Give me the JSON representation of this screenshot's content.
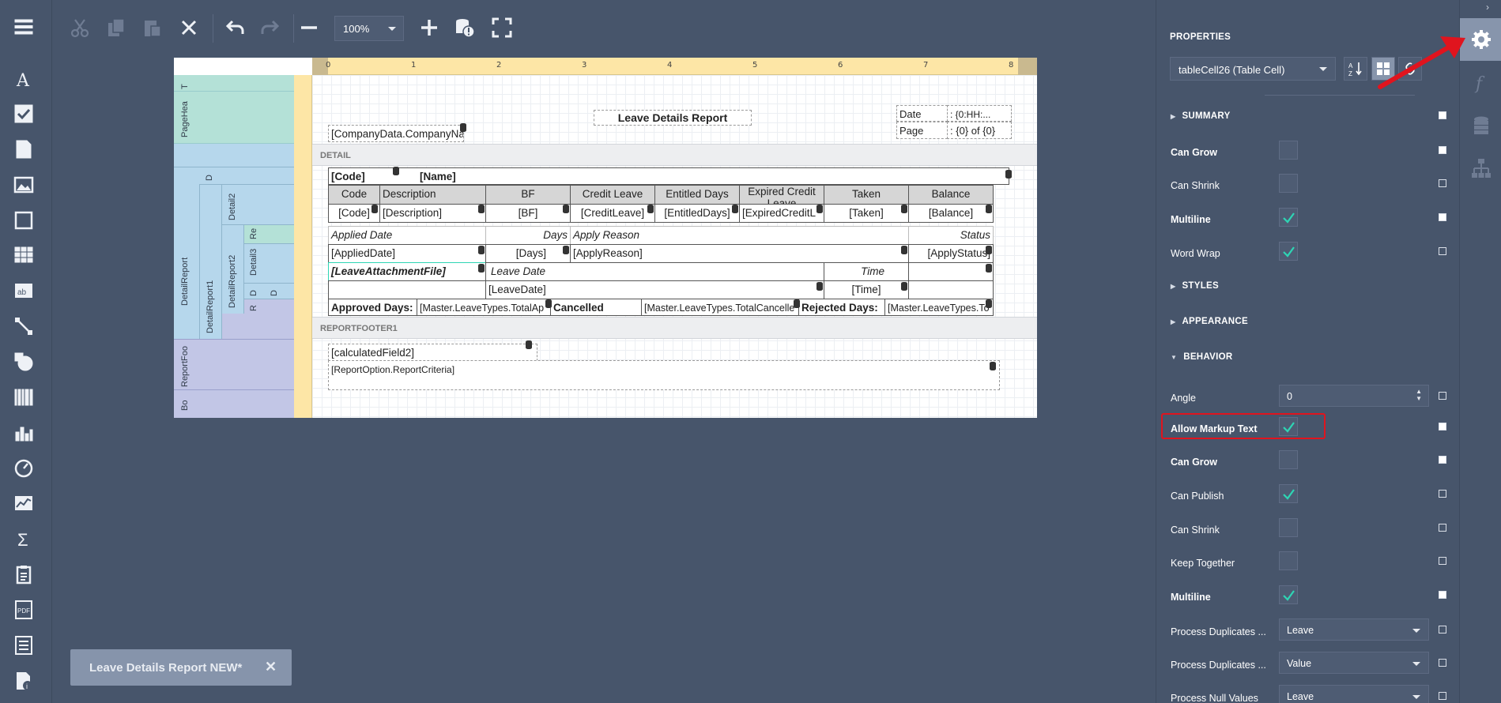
{
  "toolbar": {
    "zoom_value": "100%"
  },
  "document_tab": {
    "label": "Leave Details Report NEW*",
    "close": "✕"
  },
  "ruler_ticks": [
    "0",
    "1",
    "2",
    "3",
    "4",
    "5",
    "6",
    "7",
    "8"
  ],
  "bands": {
    "page_header": "PageHea",
    "top_margin": "T",
    "detail_strip": "DETAIL",
    "detail_report": "DetailReport",
    "detail_report1": "DetailReport1",
    "detail_report2": "DetailReport2",
    "detail2": "Detail2",
    "detail3": "Detail3",
    "d": "D",
    "re": "Re",
    "r": "R",
    "report_footer_strip": "REPORTFOOTER1",
    "report_footer": "ReportFoo",
    "bottom_margin": "Bo"
  },
  "report": {
    "title": "Leave Details Report",
    "company": "[CompanyData.CompanyName]",
    "date_label": "Date",
    "date_value": ": {0:HH:...",
    "page_label": "Page",
    "page_value": ": {0} of {0}",
    "code_bold": "[Code]",
    "name_bold": "[Name]",
    "headers": [
      "Code",
      "Description",
      "BF",
      "Credit Leave",
      "Entitled Days",
      "Expired Credit Leave",
      "Taken",
      "Balance"
    ],
    "values": [
      "[Code]",
      "[Description]",
      "[BF]",
      "[CreditLeave]",
      "[EntitledDays]",
      "[ExpiredCreditL",
      "[Taken]",
      "[Balance]"
    ],
    "applied_date_lbl": "Applied Date",
    "days_lbl": "Days",
    "apply_reason_lbl": "Apply Reason",
    "status_lbl": "Status",
    "applied_date_val": "[AppliedDate]",
    "days_val": "[Days]",
    "apply_reason_val": "[ApplyReason]",
    "apply_status_val": "[ApplyStatus]",
    "attachment": "[LeaveAttachmentFile]",
    "leave_date_lbl": "Leave Date",
    "time_lbl": "Time",
    "leave_date_val": "[LeaveDate]",
    "time_val": "[Time]",
    "approved_days_lbl": "Approved Days:",
    "approved_days_val": "[Master.LeaveTypes.TotalAp",
    "cancelled_lbl": "Cancelled",
    "cancelled_val": "[Master.LeaveTypes.TotalCancelle",
    "rejected_days_lbl": "Rejected Days:",
    "rejected_days_val": "[Master.LeaveTypes.To",
    "calc_field": "[calculatedField2]",
    "report_criteria": "[ReportOption.ReportCriteria]"
  },
  "properties": {
    "title": "PROPERTIES",
    "selected_object": "tableCell26 (Table Cell)",
    "sections": {
      "summary": "SUMMARY",
      "styles": "STYLES",
      "appearance": "APPEARANCE",
      "behavior": "BEHAVIOR"
    },
    "summary_rows": [
      {
        "label": "Can Grow",
        "checked": false,
        "bold": true
      },
      {
        "label": "Can Shrink",
        "checked": false,
        "bold": false
      },
      {
        "label": "Multiline",
        "checked": true,
        "bold": true
      },
      {
        "label": "Word Wrap",
        "checked": true,
        "bold": false
      }
    ],
    "angle_label": "Angle",
    "angle_value": "0",
    "behavior_rows": [
      {
        "label": "Allow Markup Text",
        "checked": true,
        "bold": true
      },
      {
        "label": "Can Grow",
        "checked": false,
        "bold": true
      },
      {
        "label": "Can Publish",
        "checked": true,
        "bold": false
      },
      {
        "label": "Can Shrink",
        "checked": false,
        "bold": false
      },
      {
        "label": "Keep Together",
        "checked": false,
        "bold": false
      },
      {
        "label": "Multiline",
        "checked": true,
        "bold": true
      }
    ],
    "dropdown_rows": [
      {
        "label": "Process Duplicates ...",
        "value": "Leave"
      },
      {
        "label": "Process Duplicates ...",
        "value": "Value"
      },
      {
        "label": "Process Null Values",
        "value": "Leave"
      }
    ]
  },
  "colors": {
    "accent_check": "#2ed5b4",
    "highlight": "#e0141e",
    "background": "#47556b"
  }
}
